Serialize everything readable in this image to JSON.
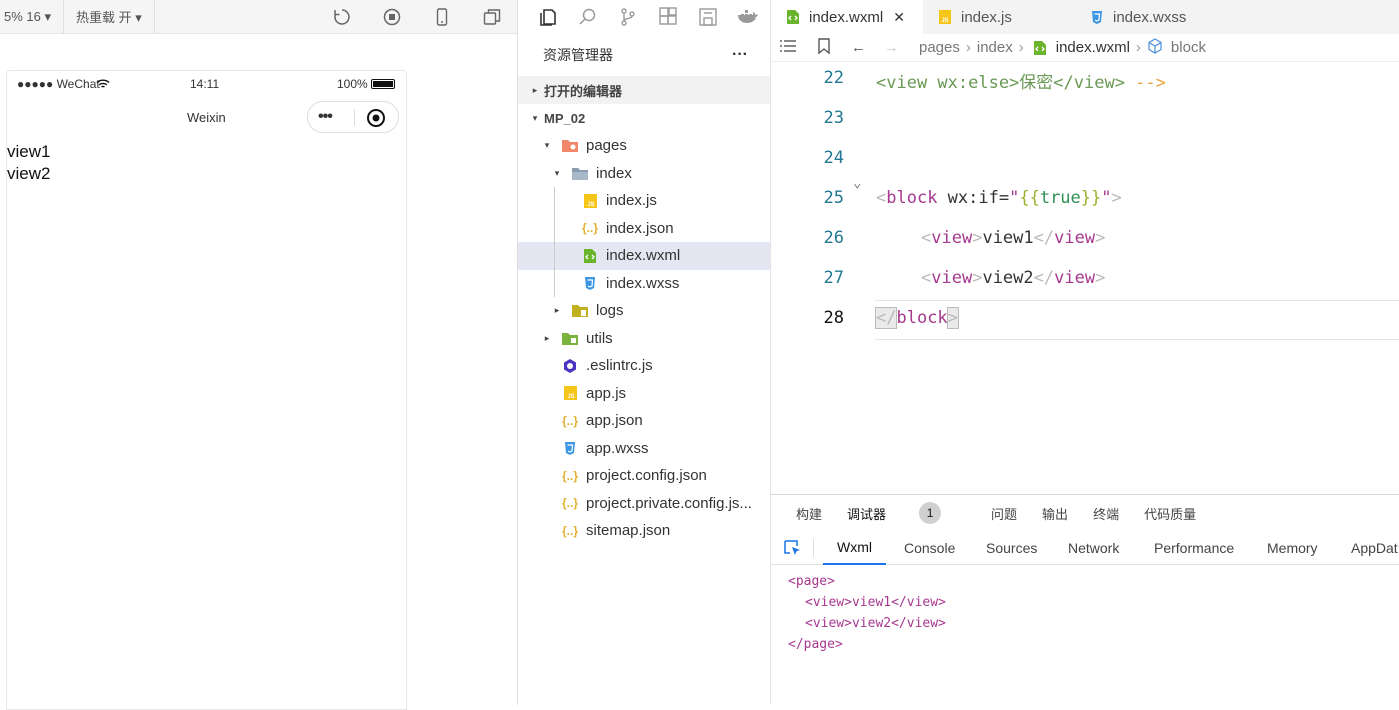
{
  "sim_toolbar": {
    "zoom": "5% 16 ▾",
    "hotreload": "热重载 开 ▾"
  },
  "phone": {
    "carrier": "●●●●● WeChat",
    "time": "14:11",
    "battery": "100%",
    "nav_title": "Weixin",
    "lines": [
      "view1",
      "view2"
    ]
  },
  "explorer": {
    "title": "资源管理器",
    "more": "···",
    "open_editors": "打开的编辑器",
    "project": "MP_02",
    "items": [
      {
        "label": "pages",
        "depth": 1,
        "arrow": "▾",
        "icon": "pages-folder-icon"
      },
      {
        "label": "index",
        "depth": 2,
        "arrow": "▾",
        "icon": "folder-icon"
      },
      {
        "label": "index.js",
        "depth": 3,
        "arrow": "",
        "icon": "js-file-icon"
      },
      {
        "label": "index.json",
        "depth": 3,
        "arrow": "",
        "icon": "json-file-icon"
      },
      {
        "label": "index.wxml",
        "depth": 3,
        "arrow": "",
        "icon": "wxml-file-icon",
        "selected": true
      },
      {
        "label": "index.wxss",
        "depth": 3,
        "arrow": "",
        "icon": "wxss-file-icon"
      },
      {
        "label": "logs",
        "depth": 2,
        "arrow": "▸",
        "icon": "logs-folder-icon"
      },
      {
        "label": "utils",
        "depth": 1,
        "arrow": "▸",
        "icon": "utils-folder-icon"
      },
      {
        "label": ".eslintrc.js",
        "depth": 1,
        "arrow": "",
        "icon": "eslint-file-icon"
      },
      {
        "label": "app.js",
        "depth": 1,
        "arrow": "",
        "icon": "js-file-icon"
      },
      {
        "label": "app.json",
        "depth": 1,
        "arrow": "",
        "icon": "json-file-icon"
      },
      {
        "label": "app.wxss",
        "depth": 1,
        "arrow": "",
        "icon": "wxss-file-icon"
      },
      {
        "label": "project.config.json",
        "depth": 1,
        "arrow": "",
        "icon": "json-file-icon"
      },
      {
        "label": "project.private.config.js...",
        "depth": 1,
        "arrow": "",
        "icon": "json-file-icon"
      },
      {
        "label": "sitemap.json",
        "depth": 1,
        "arrow": "",
        "icon": "json-file-icon"
      }
    ]
  },
  "editor": {
    "tabs": [
      {
        "label": "index.wxml",
        "icon": "wxml-file-icon",
        "active": true,
        "close": "✕"
      },
      {
        "label": "index.js",
        "icon": "js-file-icon",
        "active": false
      },
      {
        "label": "index.wxss",
        "icon": "wxss-file-icon",
        "active": false
      }
    ],
    "breadcrumb": [
      "pages",
      "index",
      "index.wxml",
      "block"
    ],
    "line_numbers": [
      "22",
      "23",
      "24",
      "25",
      "26",
      "27",
      "28"
    ],
    "code": {
      "l22a": "<view wx:else>",
      "l22b": "保密",
      "l22c": "</view>",
      "l22d": " -->",
      "l25_open": "<",
      "l25_tag": "block",
      "l25_attr": " wx:if=",
      "l25_q1": "\"",
      "l25_b1": "{{",
      "l25_val": "true",
      "l25_b2": "}}",
      "l25_q2": "\"",
      "l25_close": ">",
      "l26_o": "<",
      "l26_t": "view",
      "l26_c": ">",
      "l26_text": "view1",
      "l26_e": "</",
      "l26_t2": "view",
      "l26_e2": ">",
      "l27_o": "<",
      "l27_t": "view",
      "l27_c": ">",
      "l27_text": "view2",
      "l27_e": "</",
      "l27_t2": "view",
      "l27_e2": ">",
      "l28_o": "</",
      "l28_t": "block",
      "l28_c": ">"
    }
  },
  "panel": {
    "tabs": [
      "构建",
      "调试器",
      "问题",
      "输出",
      "终端",
      "代码质量"
    ],
    "debugger_badge": "1",
    "devtabs": [
      "Wxml",
      "Console",
      "Sources",
      "Network",
      "Performance",
      "Memory",
      "AppDat"
    ],
    "wxml": [
      "<page>",
      "<view>view1</view>",
      "<view>view2</view>",
      "</page>"
    ]
  },
  "colors": {
    "accent": "#1a73e8",
    "tag": "#a7388f",
    "string": "#9ab32f",
    "linenum": "#237893"
  }
}
